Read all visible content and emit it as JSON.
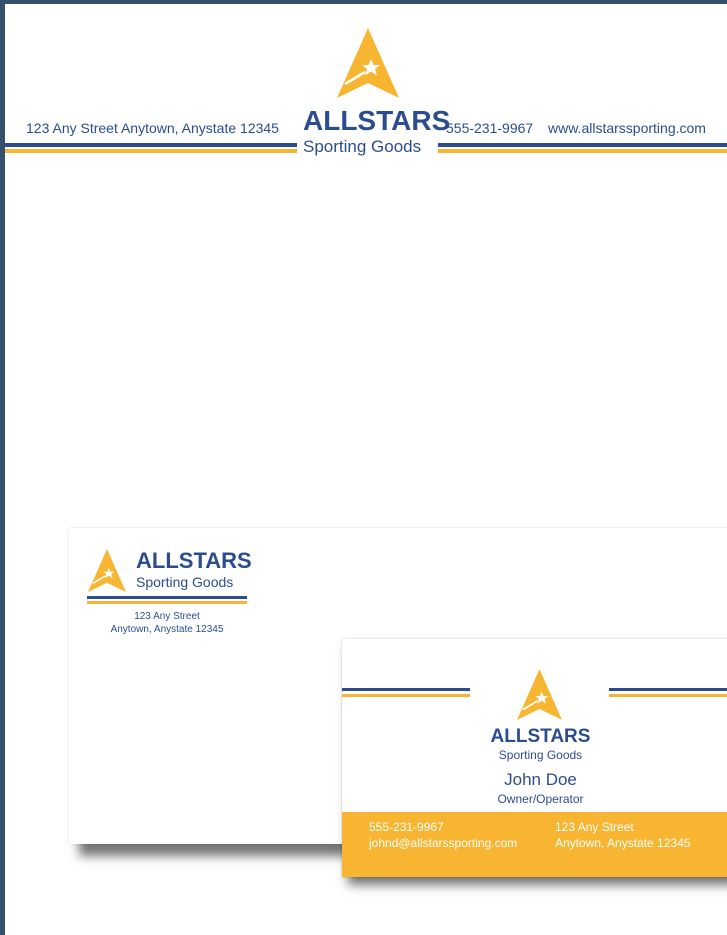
{
  "letterhead": {
    "address": "123 Any Street  Anytown, Anystate 12345",
    "brand_name": "ALLSTARS",
    "brand_sub": "Sporting Goods",
    "phone": "555-231-9967",
    "website": "www.allstarssporting.com"
  },
  "envelope": {
    "brand_name": "ALLSTARS",
    "brand_sub": "Sporting Goods",
    "address_line1": "123 Any Street",
    "address_line2": "Anytown, Anystate 12345"
  },
  "business_card": {
    "brand_name": "ALLSTARS",
    "brand_sub": "Sporting Goods",
    "person_name": "John Doe",
    "person_title": "Owner/Operator",
    "phone": "555-231-9967",
    "email": "johnd@allstarssporting.com",
    "address_line1": "123 Any Street",
    "address_line2": "Anytown, Anystate 12345"
  },
  "colors": {
    "brand_blue": "#2b4d8f",
    "brand_gold": "#f7b532",
    "frame": "#34506b"
  },
  "icons": {
    "logo": "star-triangle-logo-icon"
  }
}
